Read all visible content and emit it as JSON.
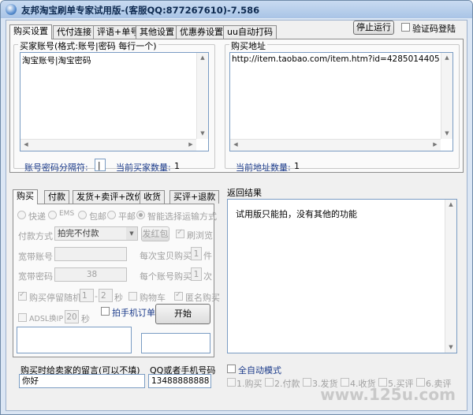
{
  "window": {
    "title": "友邦淘宝刷单专家试用版-(客服QQ:877267610)-7.586"
  },
  "top_tabs": [
    "购买设置",
    "代付连接",
    "评语+单号",
    "其他设置",
    "优惠券设置",
    "uu自动打码"
  ],
  "stop_button": "停止运行",
  "captcha_login": "验证码登陆",
  "buyer": {
    "group_label": "买家账号(格式:账号|密码 每行一个)",
    "text": "淘宝账号|淘宝密码",
    "separator_label": "账号密码分隔符:",
    "separator_value": "|",
    "count_label": "当前买家数量:",
    "count_value": "1"
  },
  "url": {
    "group_label": "购买地址",
    "text": "http://item.taobao.com/item.htm?id=4285014405",
    "count_label": "当前地址数量:",
    "count_value": "1"
  },
  "bottom_tabs": [
    "购买",
    "付款",
    "发货+卖评+改价",
    "收货",
    "买评+退款"
  ],
  "buy": {
    "shipping": [
      "快递",
      "EMS",
      "包邮",
      "平邮",
      "智能选择运输方式"
    ],
    "payment_label": "付款方式",
    "payment_value": "拍完不付款",
    "red_packet": "发红包",
    "brush_flow": "刷浏览",
    "broadband_account": "宽带账号",
    "broadband_password": "宽带密码",
    "broadband_password_value": "38",
    "per_item_label": "每次宝贝购买",
    "per_item_value": "1",
    "per_item_unit": "件",
    "per_account_label": "每个账号购买",
    "per_account_value": "1",
    "per_account_unit": "次",
    "wait_label": "购买停留随机",
    "wait_from": "1",
    "wait_dash": "-",
    "wait_to": "2",
    "wait_unit": "秒",
    "cart": "购物车",
    "anonymous": "匿名购买",
    "adsl_label": "ADSL换IP",
    "adsl_value": "20",
    "adsl_unit": "秒",
    "mobile_order": "拍手机订单",
    "start_button": "开始"
  },
  "result": {
    "group_label": "返回结果",
    "text": "试用版只能拍，没有其他的功能"
  },
  "message": {
    "label": "购买时给卖家的留言(可以不填)",
    "value": "你好"
  },
  "phone": {
    "label": "QQ或者手机号码",
    "value": "13488888888"
  },
  "auto_mode": {
    "label": "全自动模式",
    "steps": [
      "1.购买",
      "2.付款",
      "3.发货",
      "4.收货",
      "5.买评",
      "6.卖评"
    ]
  },
  "watermark": "www.125u.com"
}
